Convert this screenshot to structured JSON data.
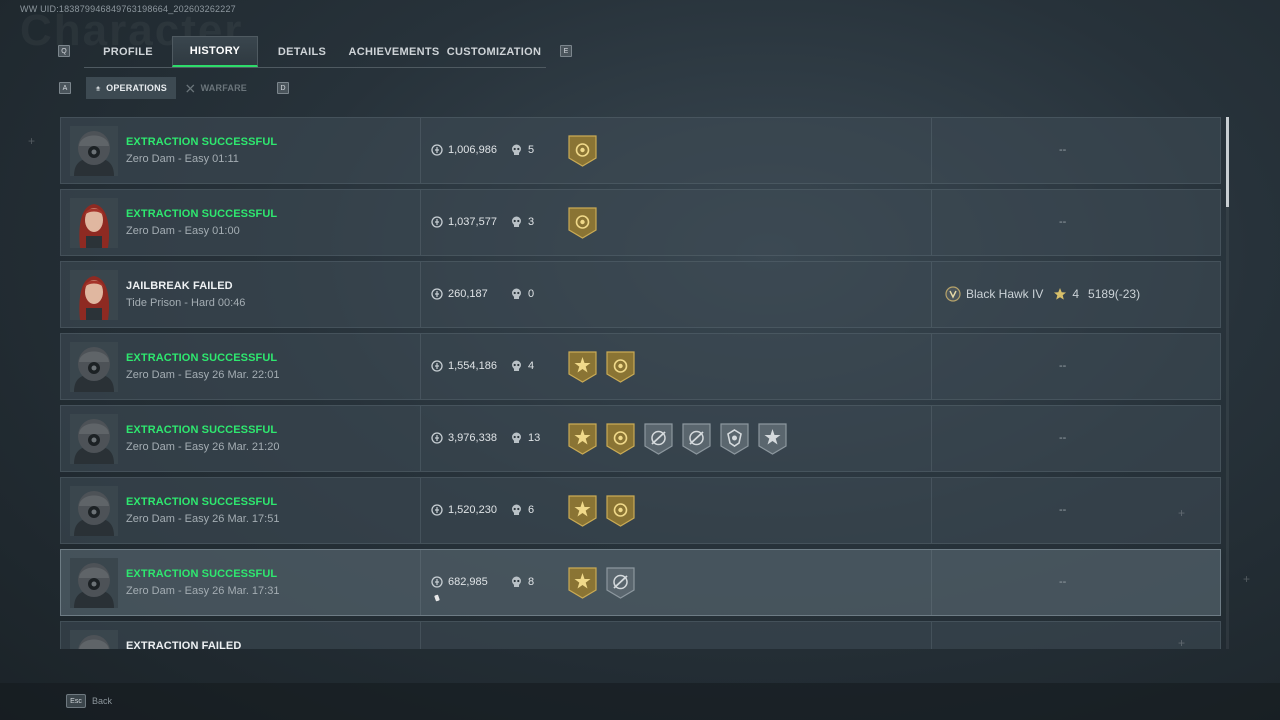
{
  "uid": "WW UID:183879946849763198664_202603262227",
  "background_text": "Character",
  "tabs": {
    "prev_key": "Q",
    "next_key": "E",
    "items": [
      {
        "label": "PROFILE",
        "active": false
      },
      {
        "label": "HISTORY",
        "active": true
      },
      {
        "label": "DETAILS",
        "active": false
      },
      {
        "label": "ACHIEVEMENTS",
        "active": false
      },
      {
        "label": "CUSTOMIZATION",
        "active": false
      }
    ]
  },
  "subtabs": {
    "prev_key": "A",
    "next_key": "D",
    "items": [
      {
        "label": "OPERATIONS",
        "active": true,
        "icon": "operations-icon"
      },
      {
        "label": "WARFARE",
        "active": false,
        "icon": "warfare-icon"
      }
    ]
  },
  "rows": [
    {
      "status": "EXTRACTION SUCCESSFUL",
      "outcome": "success",
      "avatar": "helmet-operator",
      "map": "Zero Dam - Easy 01:11",
      "value": "1,006,986",
      "kills": "5",
      "badges": [
        "gold-circle"
      ],
      "rank": null,
      "dash": "--"
    },
    {
      "status": "EXTRACTION SUCCESSFUL",
      "outcome": "success",
      "avatar": "red-hair-operator",
      "map": "Zero Dam - Easy 01:00",
      "value": "1,037,577",
      "kills": "3",
      "badges": [
        "gold-circle"
      ],
      "rank": null,
      "dash": "--"
    },
    {
      "status": "JAILBREAK FAILED",
      "outcome": "fail",
      "avatar": "red-hair-operator",
      "map": "Tide Prison - Hard 00:46",
      "value": "260,187",
      "kills": "0",
      "badges": [],
      "rank": {
        "name": "Black Hawk IV",
        "stars": "4",
        "score": "5189(-23)"
      },
      "dash": ""
    },
    {
      "status": "EXTRACTION SUCCESSFUL",
      "outcome": "success",
      "avatar": "helmet-operator",
      "map": "Zero Dam - Easy 26 Mar. 22:01",
      "value": "1,554,186",
      "kills": "4",
      "badges": [
        "gold-star",
        "gold-circle"
      ],
      "rank": null,
      "dash": "--"
    },
    {
      "status": "EXTRACTION SUCCESSFUL",
      "outcome": "success",
      "avatar": "helmet-operator",
      "map": "Zero Dam - Easy 26 Mar. 21:20",
      "value": "3,976,338",
      "kills": "13",
      "badges": [
        "gold-star",
        "gold-circle",
        "silver-slash",
        "silver-slash",
        "silver-crest",
        "silver-star"
      ],
      "rank": null,
      "dash": "--"
    },
    {
      "status": "EXTRACTION SUCCESSFUL",
      "outcome": "success",
      "avatar": "helmet-operator",
      "map": "Zero Dam - Easy 26 Mar. 17:51",
      "value": "1,520,230",
      "kills": "6",
      "badges": [
        "gold-star",
        "gold-circle"
      ],
      "rank": null,
      "dash": "--"
    },
    {
      "status": "EXTRACTION SUCCESSFUL",
      "outcome": "success",
      "avatar": "helmet-operator",
      "map": "Zero Dam - Easy 26 Mar. 17:31",
      "value": "682,985",
      "kills": "8",
      "badges": [
        "gold-star",
        "silver-slash"
      ],
      "rank": null,
      "dash": "--"
    },
    {
      "status": "EXTRACTION FAILED",
      "outcome": "fail",
      "avatar": "helmet-operator",
      "map": "",
      "value": "",
      "kills": "",
      "badges": [],
      "rank": null,
      "dash": ""
    }
  ],
  "footer": {
    "key": "Esc",
    "label": "Back"
  },
  "colors": {
    "success": "#2ee86f",
    "accent_tab": "#2ddc6a",
    "badge_gold": "#8a7434",
    "badge_silver": "#5a666e"
  }
}
